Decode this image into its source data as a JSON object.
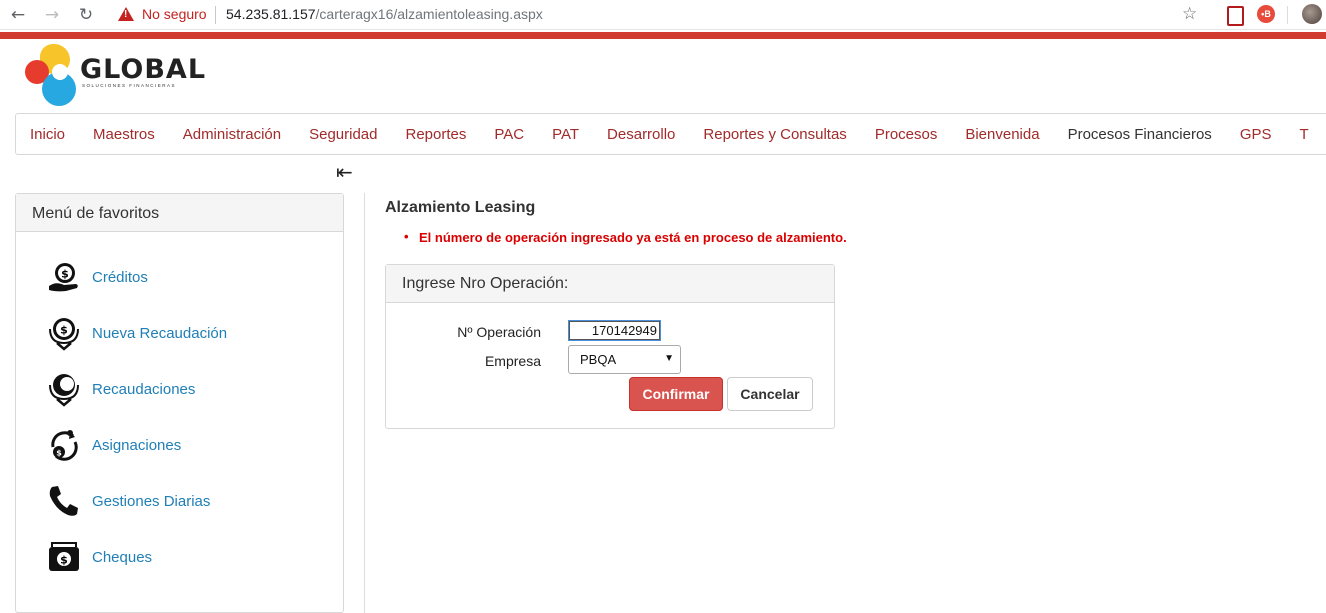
{
  "browser": {
    "security_label": "No seguro",
    "url_host": "54.235.81.157",
    "url_path": "/carteragx16/alzamientoleasing.aspx"
  },
  "logo": {
    "brand": "GLOBAL",
    "tagline": "SOLUCIONES FINANCIERAS"
  },
  "menu": [
    {
      "label": "Inicio"
    },
    {
      "label": "Maestros"
    },
    {
      "label": "Administración"
    },
    {
      "label": "Seguridad"
    },
    {
      "label": "Reportes"
    },
    {
      "label": "PAC"
    },
    {
      "label": "PAT"
    },
    {
      "label": "Desarrollo"
    },
    {
      "label": "Reportes y Consultas"
    },
    {
      "label": "Procesos"
    },
    {
      "label": "Bienvenida"
    },
    {
      "label": "Procesos Financieros"
    },
    {
      "label": "GPS"
    },
    {
      "label": "T"
    }
  ],
  "collapse_glyph": "⇤",
  "favorites": {
    "title": "Menú de favoritos",
    "items": [
      {
        "label": "Créditos",
        "icon": "coin-hand-icon"
      },
      {
        "label": "Nueva Recaudación",
        "icon": "coin-download-icon"
      },
      {
        "label": "Recaudaciones",
        "icon": "coin-download-icon"
      },
      {
        "label": "Asignaciones",
        "icon": "coin-cycle-icon"
      },
      {
        "label": "Gestiones Diarias",
        "icon": "phone-icon"
      },
      {
        "label": "Cheques",
        "icon": "cash-icon"
      }
    ]
  },
  "main": {
    "title": "Alzamiento Leasing",
    "error": "El número de operación ingresado ya está en proceso de alzamiento.",
    "panel_title": "Ingrese Nro Operación:",
    "op_label": "Nº Operación",
    "op_value": "170142949",
    "company_label": "Empresa",
    "company_value": "PBQA",
    "confirm_label": "Confirmar",
    "cancel_label": "Cancelar"
  },
  "colors": {
    "accent": "#d23b2f",
    "menu_text": "#a12b2b",
    "link": "#1f7fb6",
    "error": "#d90000",
    "confirm": "#d9534f"
  }
}
